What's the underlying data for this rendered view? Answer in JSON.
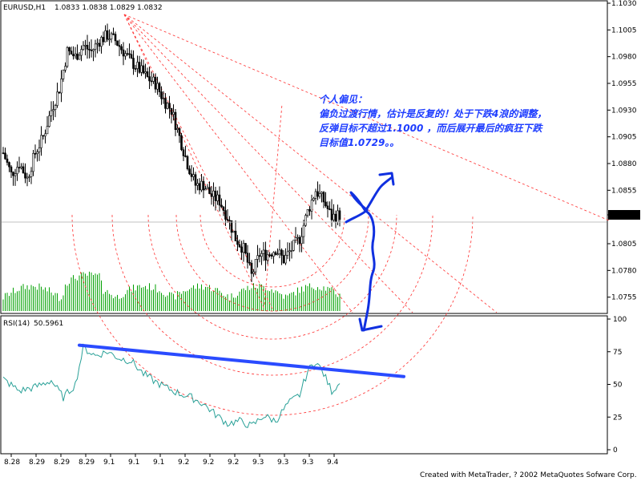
{
  "header": {
    "symbol_label": "EURUSD,H1",
    "quote": "1.0833 1.0838 1.0829 1.0832"
  },
  "rsi": {
    "label": "RSI(14)",
    "value": "50.5961"
  },
  "footer": {
    "credit": "Created with MetaTrader, ? 2002 MetaQuotes Sofware Corp."
  },
  "annotation": {
    "lines": [
      "个人偏见：",
      "偏负过渡行情，估计是反复的！处于下跌4浪的调整，",
      "反弹目标不超过1.1000 ，而后展开最后的疯狂下跌",
      "目标值1.0729。。"
    ]
  },
  "colors": {
    "up_candle": "#000000",
    "volume": "#00a000",
    "rsi_line": "#2aa198",
    "trend_line": "#2a4bff",
    "fib_dashed": "#ff3030",
    "current_price_line": "#c0c0c0",
    "hand_drawn": "#1030e0"
  },
  "chart_data": [
    {
      "type": "candlestick",
      "title": "EURUSD,H1",
      "y_ticks": [
        "1.1030",
        "1.1005",
        "1.0980",
        "1.0955",
        "1.0930",
        "1.0905",
        "1.0880",
        "1.0855",
        "1.0832",
        "1.0805",
        "1.0780",
        "1.0755"
      ],
      "ylim": [
        1.0745,
        1.103
      ],
      "current_price": 1.0832,
      "x_tick_labels": [
        "8.28",
        "8.29",
        "8.29",
        "8.29",
        "9.1",
        "9.1",
        "9.1",
        "9.2",
        "9.2",
        "9.2",
        "9.3",
        "9.3",
        "9.3",
        "9.4"
      ],
      "close_path": [
        {
          "i": 0,
          "v": 1.089
        },
        {
          "i": 4,
          "v": 1.087
        },
        {
          "i": 8,
          "v": 1.088
        },
        {
          "i": 12,
          "v": 1.0866
        },
        {
          "i": 16,
          "v": 1.089
        },
        {
          "i": 20,
          "v": 1.0905
        },
        {
          "i": 24,
          "v": 1.093
        },
        {
          "i": 28,
          "v": 1.095
        },
        {
          "i": 32,
          "v": 1.0985
        },
        {
          "i": 36,
          "v": 1.098
        },
        {
          "i": 40,
          "v": 1.099
        },
        {
          "i": 44,
          "v": 1.0985
        },
        {
          "i": 48,
          "v": 1.0995
        },
        {
          "i": 52,
          "v": 1.1
        },
        {
          "i": 56,
          "v": 1.0995
        },
        {
          "i": 60,
          "v": 1.0985
        },
        {
          "i": 64,
          "v": 1.0975
        },
        {
          "i": 68,
          "v": 1.0968
        },
        {
          "i": 72,
          "v": 1.096
        },
        {
          "i": 76,
          "v": 1.0955
        },
        {
          "i": 80,
          "v": 1.094
        },
        {
          "i": 84,
          "v": 1.093
        },
        {
          "i": 88,
          "v": 1.0905
        },
        {
          "i": 92,
          "v": 1.088
        },
        {
          "i": 96,
          "v": 1.086
        },
        {
          "i": 100,
          "v": 1.086
        },
        {
          "i": 104,
          "v": 1.085
        },
        {
          "i": 108,
          "v": 1.0845
        },
        {
          "i": 112,
          "v": 1.083
        },
        {
          "i": 116,
          "v": 1.081
        },
        {
          "i": 120,
          "v": 1.08
        },
        {
          "i": 124,
          "v": 1.0775
        },
        {
          "i": 128,
          "v": 1.0795
        },
        {
          "i": 132,
          "v": 1.0795
        },
        {
          "i": 136,
          "v": 1.08
        },
        {
          "i": 140,
          "v": 1.079
        },
        {
          "i": 144,
          "v": 1.08
        },
        {
          "i": 148,
          "v": 1.081
        },
        {
          "i": 152,
          "v": 1.0835
        },
        {
          "i": 156,
          "v": 1.0855
        },
        {
          "i": 160,
          "v": 1.0845
        },
        {
          "i": 164,
          "v": 1.083
        },
        {
          "i": 168,
          "v": 1.0832
        }
      ],
      "candle_count": 169
    },
    {
      "type": "line",
      "title": "RSI(14)",
      "y_ticks": [
        100,
        75,
        50,
        25,
        0
      ],
      "ylim": [
        0,
        100
      ],
      "series": [
        {
          "name": "RSI(14)",
          "points": [
            {
              "i": 0,
              "v": 54
            },
            {
              "i": 8,
              "v": 45
            },
            {
              "i": 16,
              "v": 48
            },
            {
              "i": 24,
              "v": 53
            },
            {
              "i": 30,
              "v": 40
            },
            {
              "i": 36,
              "v": 50
            },
            {
              "i": 40,
              "v": 78
            },
            {
              "i": 46,
              "v": 72
            },
            {
              "i": 52,
              "v": 75
            },
            {
              "i": 58,
              "v": 70
            },
            {
              "i": 64,
              "v": 68
            },
            {
              "i": 70,
              "v": 58
            },
            {
              "i": 76,
              "v": 52
            },
            {
              "i": 82,
              "v": 47
            },
            {
              "i": 88,
              "v": 43
            },
            {
              "i": 94,
              "v": 40
            },
            {
              "i": 100,
              "v": 35
            },
            {
              "i": 106,
              "v": 27
            },
            {
              "i": 112,
              "v": 20
            },
            {
              "i": 118,
              "v": 22
            },
            {
              "i": 124,
              "v": 18
            },
            {
              "i": 130,
              "v": 26
            },
            {
              "i": 136,
              "v": 22
            },
            {
              "i": 142,
              "v": 35
            },
            {
              "i": 148,
              "v": 42
            },
            {
              "i": 152,
              "v": 60
            },
            {
              "i": 156,
              "v": 68
            },
            {
              "i": 160,
              "v": 58
            },
            {
              "i": 164,
              "v": 45
            },
            {
              "i": 168,
              "v": 50.6
            }
          ]
        }
      ],
      "trend_line": {
        "from": {
          "i": 38,
          "v": 80
        },
        "to": {
          "i": 200,
          "v": 56
        }
      }
    }
  ]
}
